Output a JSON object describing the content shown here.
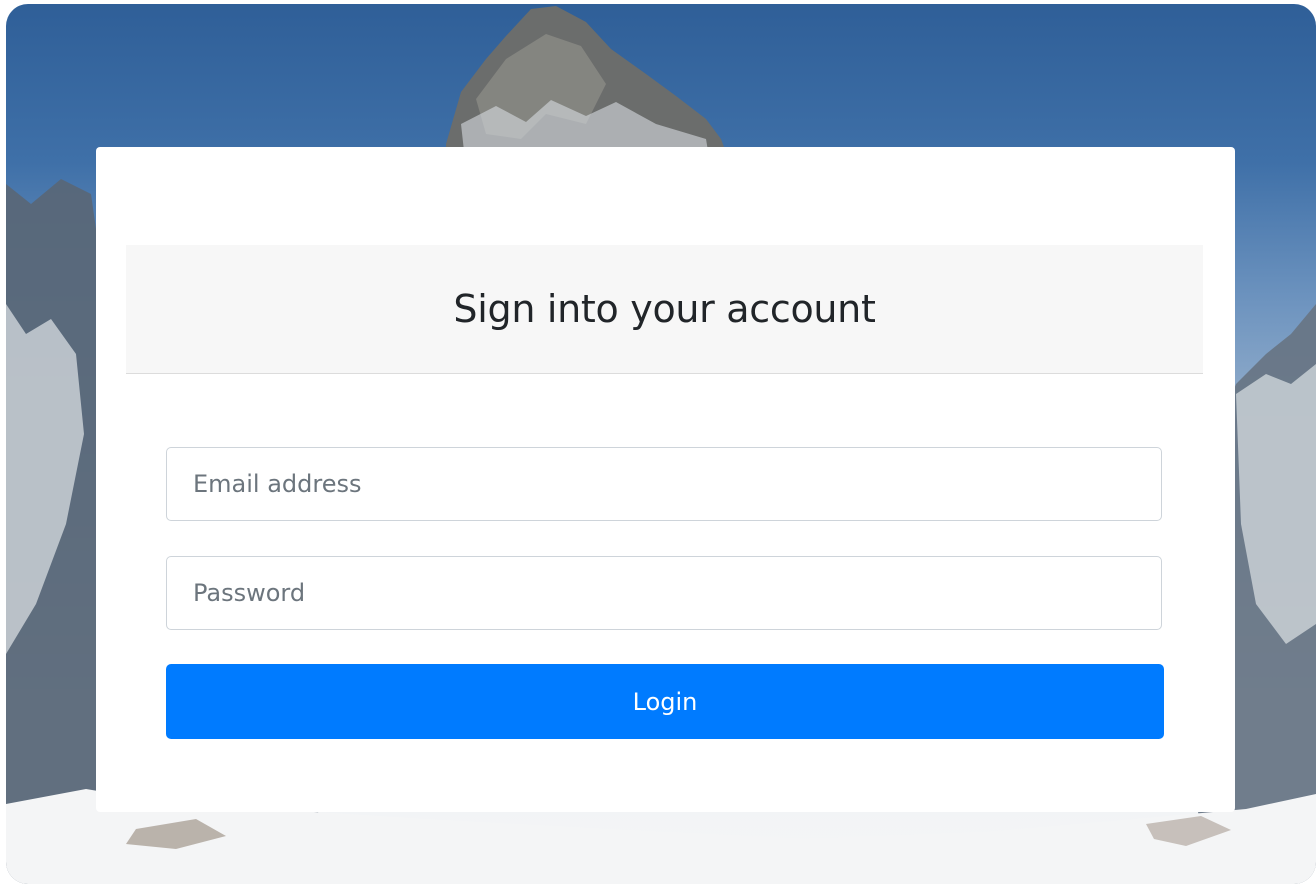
{
  "background": {
    "scene": "snow-mountain-photo",
    "sky_color": "#2f5f98",
    "snow_color": "#f5f6f7"
  },
  "login": {
    "title": "Sign into your account",
    "email_placeholder": "Email address",
    "password_placeholder": "Password",
    "submit_label": "Login",
    "accent_color": "#007bff"
  }
}
